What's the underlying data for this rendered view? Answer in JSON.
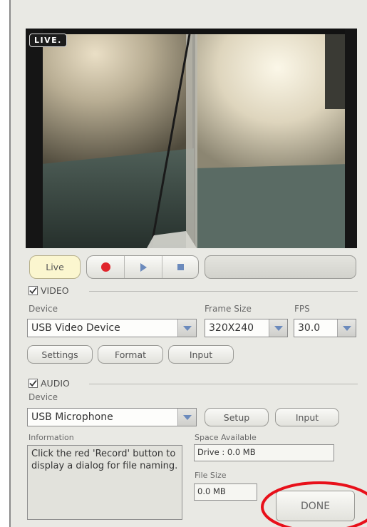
{
  "preview": {
    "live_badge": "LIVE."
  },
  "transport": {
    "live_label": "Live",
    "progress_text": ""
  },
  "video": {
    "section_label": "VIDEO",
    "checked": true,
    "device_label": "Device",
    "device_value": "USB Video Device",
    "frame_size_label": "Frame Size",
    "frame_size_value": "320X240",
    "fps_label": "FPS",
    "fps_value": "30.0",
    "settings_label": "Settings",
    "format_label": "Format",
    "input_label": "Input"
  },
  "audio": {
    "section_label": "AUDIO",
    "checked": true,
    "device_label": "Device",
    "device_value": "USB Microphone",
    "setup_label": "Setup",
    "input_label": "Input"
  },
  "info": {
    "label": "Information",
    "text": "Click the red 'Record' button to display a dialog for file naming."
  },
  "space": {
    "label": "Space Available",
    "value": "Drive : 0.0 MB"
  },
  "file_size": {
    "label": "File Size",
    "value": "0.0 MB"
  },
  "done_label": "DONE",
  "colors": {
    "record_red": "#e0242b",
    "annotation_red": "#e8101a",
    "live_button_bg": "#fbf6cf",
    "panel_bg": "#e9e9e4"
  }
}
